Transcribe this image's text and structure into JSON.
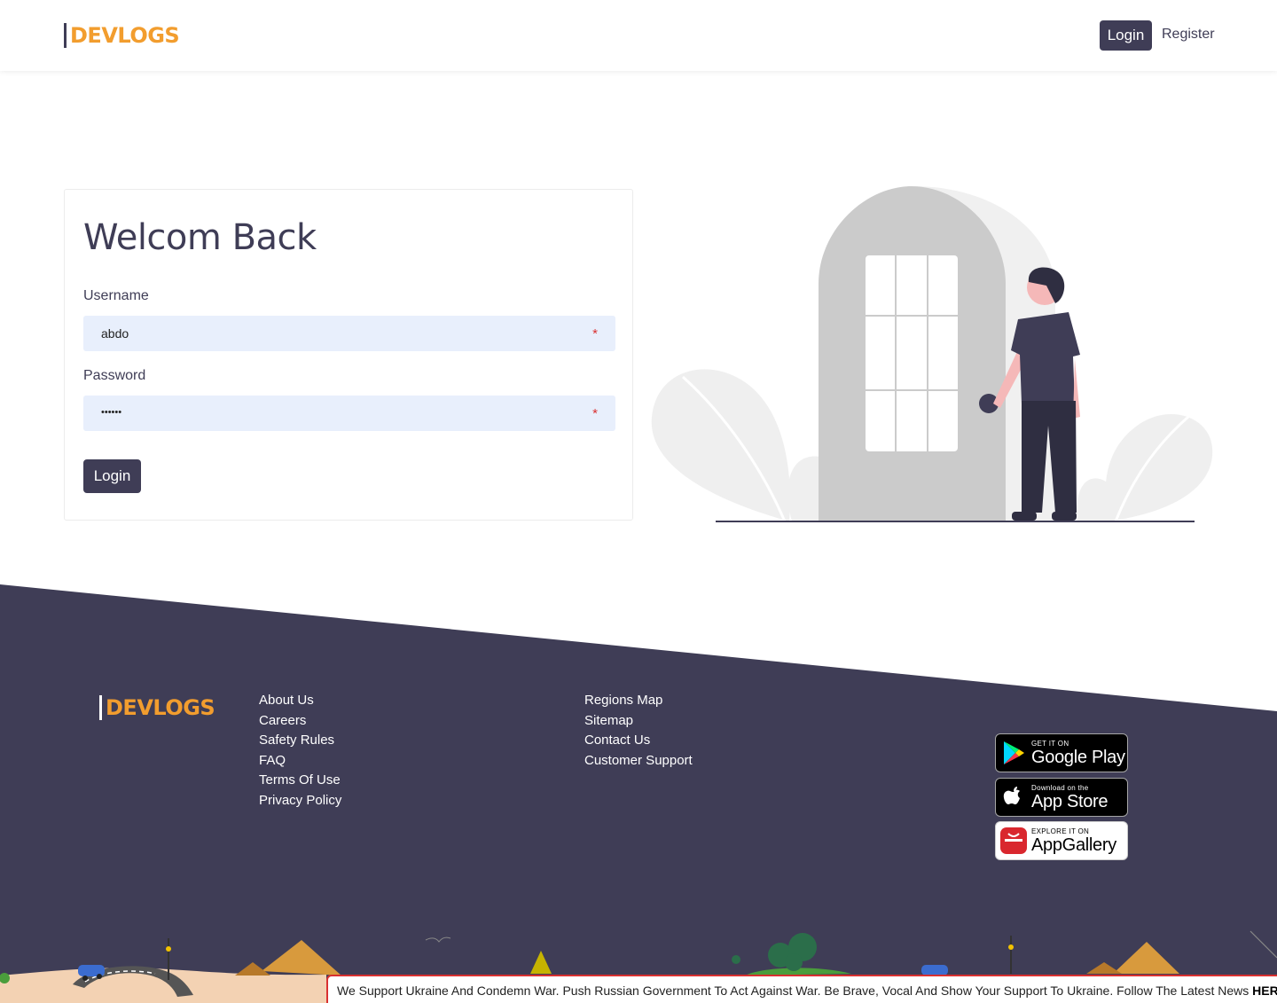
{
  "header": {
    "logo": "DEVLOGS",
    "login_label": "Login",
    "register_label": "Register"
  },
  "form": {
    "title": "Welcom Back",
    "username_label": "Username",
    "username_value": "abdo",
    "password_label": "Password",
    "password_value": "••••••",
    "required_mark": "*",
    "submit_label": "Login"
  },
  "footer": {
    "logo": "DEVLOGS",
    "links_col1": [
      "About Us",
      "Careers",
      "Safety Rules",
      "FAQ",
      "Terms Of Use",
      "Privacy Policy"
    ],
    "links_col2": [
      "Regions Map",
      "Sitemap",
      "Contact Us",
      "Customer Support"
    ],
    "stores": [
      {
        "small": "GET IT ON",
        "big": "Google Play",
        "icon": "google-play-icon"
      },
      {
        "small": "Download on the",
        "big": "App Store",
        "icon": "apple-icon"
      },
      {
        "small": "EXPLORE IT ON",
        "big": "AppGallery",
        "icon": "huawei-icon"
      }
    ]
  },
  "ticker": {
    "text": "We Support Ukraine And Condemn War. Push Russian Government To Act Against War. Be Brave, Vocal And Show Your Support To Ukraine. Follow The Latest News ",
    "link": "HERE"
  },
  "colors": {
    "primary": "#3f3d56",
    "brand": "#f29d2e",
    "input_bg": "#e8effc",
    "alert": "#d93030"
  }
}
